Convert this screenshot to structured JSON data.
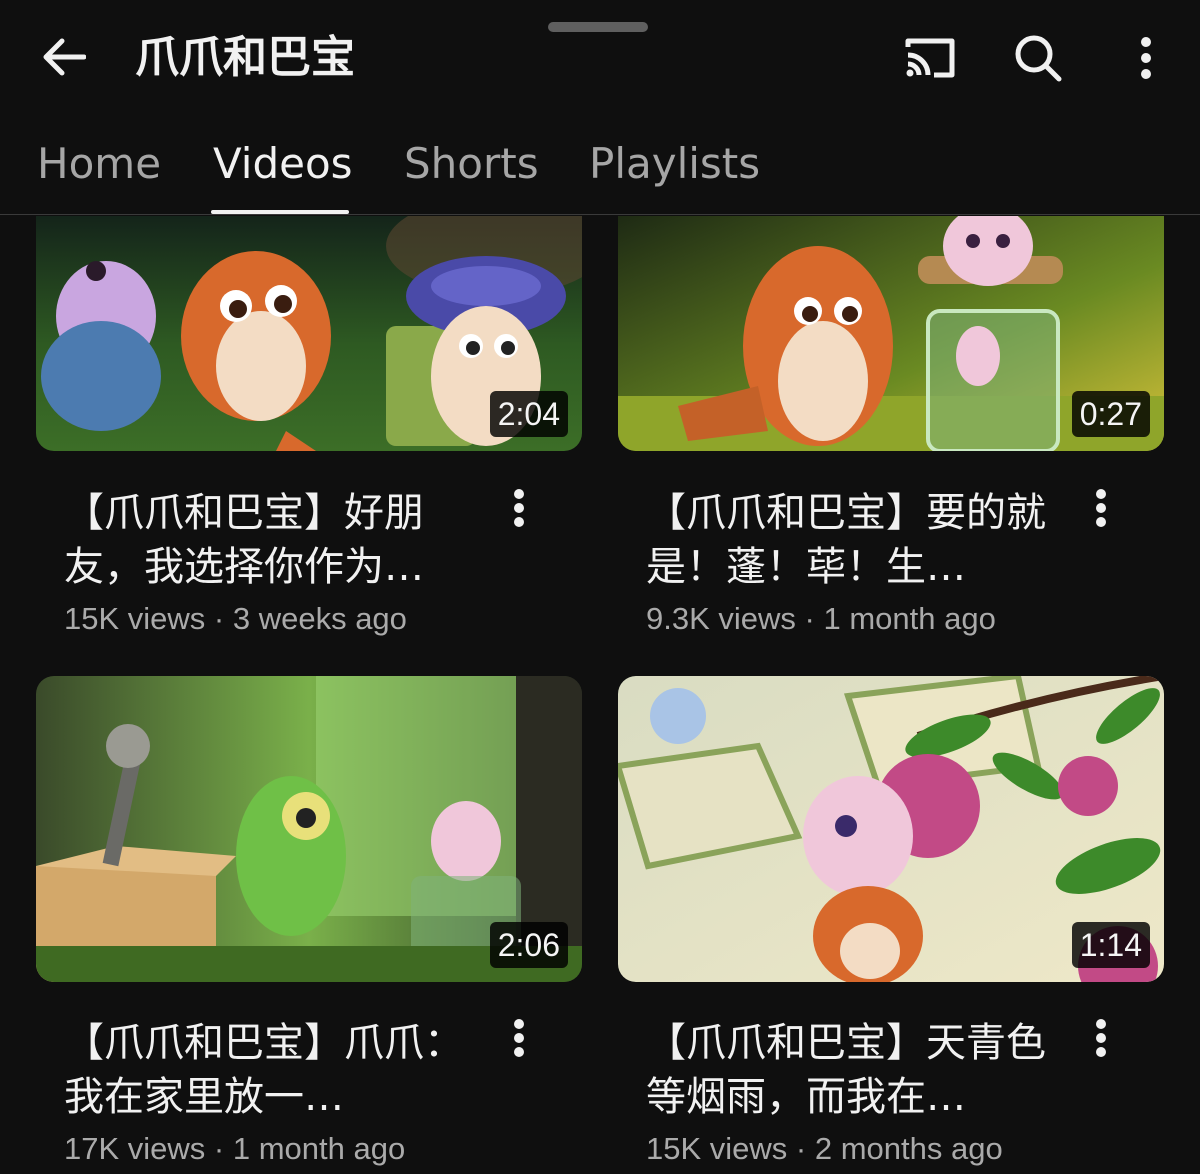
{
  "header": {
    "title": "爪爪和巴宝",
    "icons": [
      "back-arrow-icon",
      "cast-icon",
      "search-icon",
      "more-vert-icon"
    ]
  },
  "tabs": [
    {
      "label": "Home",
      "active": false
    },
    {
      "label": "Videos",
      "active": true
    },
    {
      "label": "Shorts",
      "active": false
    },
    {
      "label": "Playlists",
      "active": false
    }
  ],
  "videos": [
    {
      "title": "【爪爪和巴宝】好朋友，我选择你作为…",
      "views": "15K views",
      "age": "3 weeks ago",
      "duration": "2:04"
    },
    {
      "title": "【爪爪和巴宝】要的就是！蓬！荜！生…",
      "views": "9.3K views",
      "age": "1 month ago",
      "duration": "0:27"
    },
    {
      "title": "【爪爪和巴宝】爪爪：我在家里放一…",
      "views": "17K views",
      "age": "1 month ago",
      "duration": "2:06"
    },
    {
      "title": "【爪爪和巴宝】天青色等烟雨，而我在…",
      "views": "15K views",
      "age": "2 months ago",
      "duration": "1:14"
    }
  ],
  "colors": {
    "background": "#0f0f0f",
    "text_primary": "#f1f1f1",
    "text_secondary": "#aaaaaa",
    "tab_inactive": "#a6a6a6"
  }
}
